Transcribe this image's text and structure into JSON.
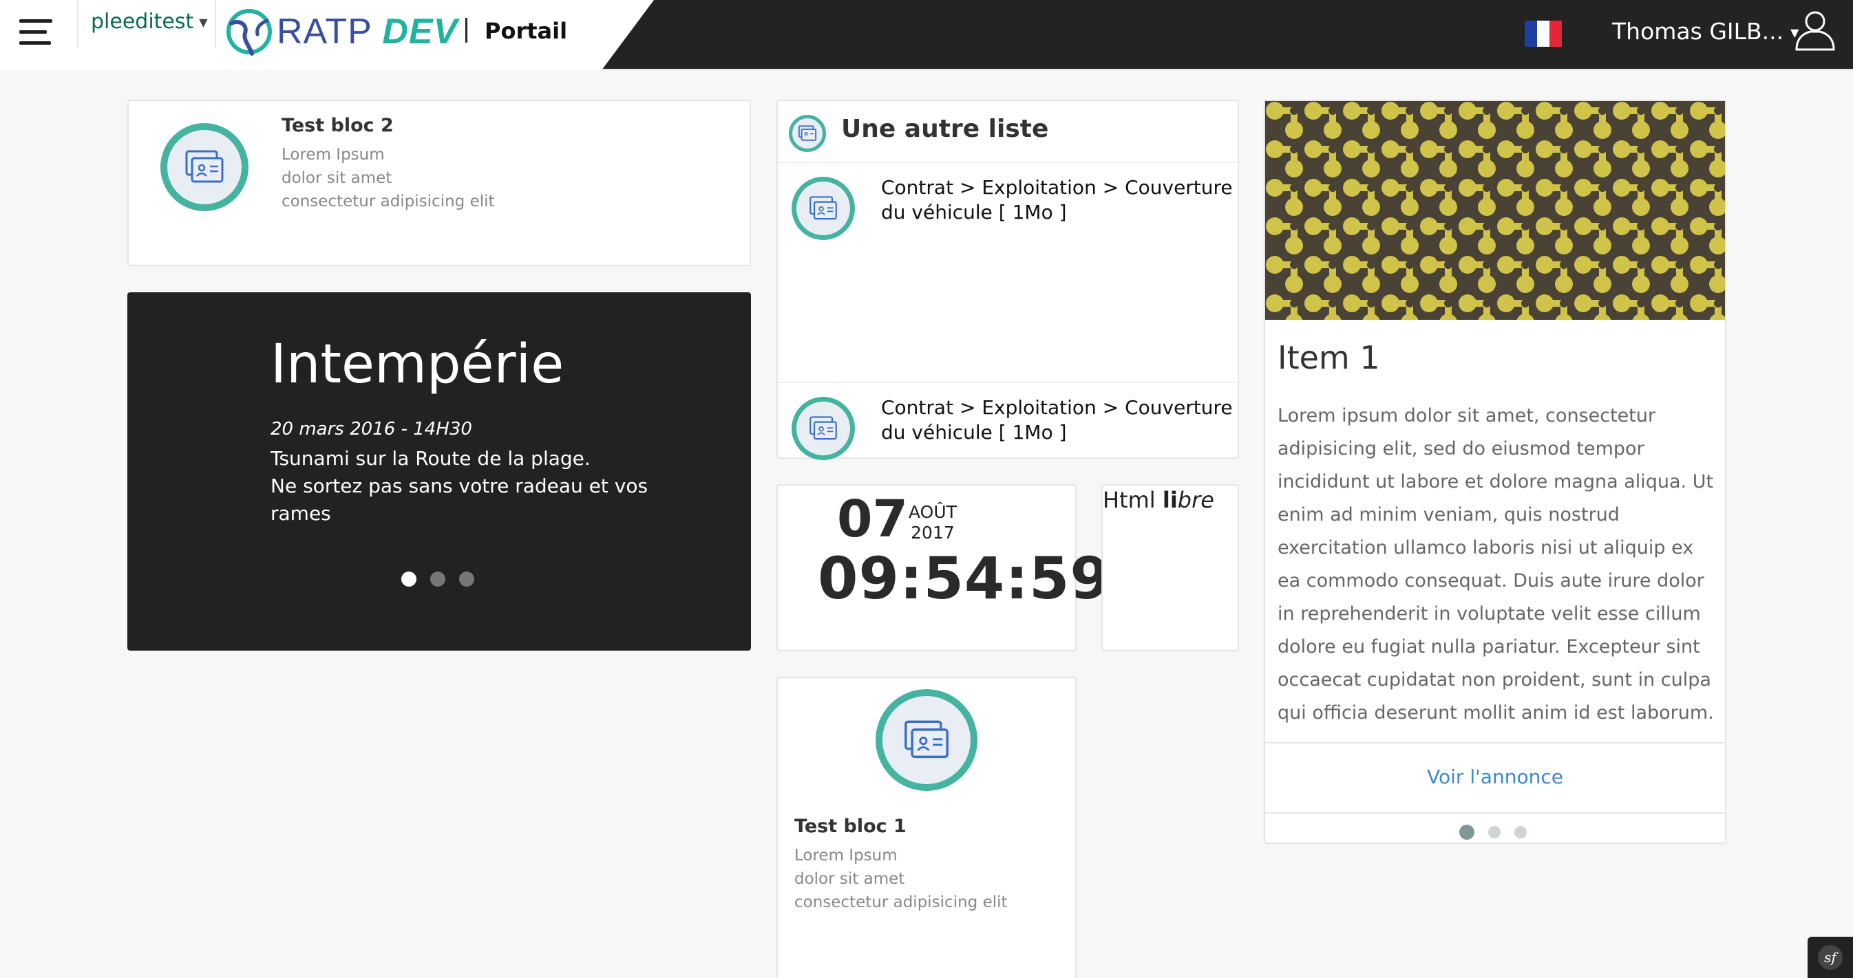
{
  "header": {
    "tenant": "pleeditest",
    "brand_ratp": "RATP",
    "brand_dev": "DEV",
    "portal_label": "Portail",
    "user_name": "Thomas GILB...",
    "language_icon": "flag-fr-icon"
  },
  "bloc2": {
    "title": "Test bloc 2",
    "lines": [
      "Lorem Ipsum",
      "dolor sit amet",
      "consectetur adipisicing elit"
    ],
    "icon": "id-card-icon"
  },
  "slider": {
    "title": "Intempérie",
    "date": "20 mars 2016 - 14H30",
    "text": "Tsunami sur la Route de la plage.\nNe sortez pas sans votre radeau et vos rames",
    "slides": 3,
    "active_slide": 1
  },
  "list": {
    "title": "Une autre liste",
    "items": [
      {
        "label": "Contrat > Exploitation > Couverture du véhicule [ 1Mo ]"
      },
      {
        "label": "Contrat > Exploitation > Couverture du véhicule [ 1Mo ]"
      }
    ]
  },
  "clock": {
    "day": "07",
    "month": "AOÛT",
    "year": "2017",
    "time": "09:54:59"
  },
  "html_libre": {
    "plain": "Html ",
    "bold": "li",
    "italic": "bre"
  },
  "bloc1": {
    "title": "Test bloc 1",
    "lines": [
      "Lorem Ipsum",
      "dolor sit amet",
      "consectetur adipisicing elit"
    ],
    "icon": "id-card-icon"
  },
  "announce": {
    "title": "Item 1",
    "text": "Lorem ipsum dolor sit amet, consectetur adipisicing elit, sed do eiusmod tempor incididunt ut labore et dolore magna aliqua. Ut enim ad minim veniam, quis nostrud exercitation ullamco laboris nisi ut aliquip ex ea commodo consequat. Duis aute irure dolor in reprehenderit in voluptate velit esse cillum dolore eu fugiat nulla pariatur. Excepteur sint occaecat cupidatat non proident, sunt in culpa qui officia deserunt mollit anim id est laborum.",
    "link_label": "Voir l'annonce",
    "slides": 3,
    "active_slide": 1
  },
  "colors": {
    "accent_teal": "#44b3a0",
    "header_dark": "#232323",
    "link_blue": "#3a88d4",
    "tenant_green": "#0a6b4b"
  }
}
